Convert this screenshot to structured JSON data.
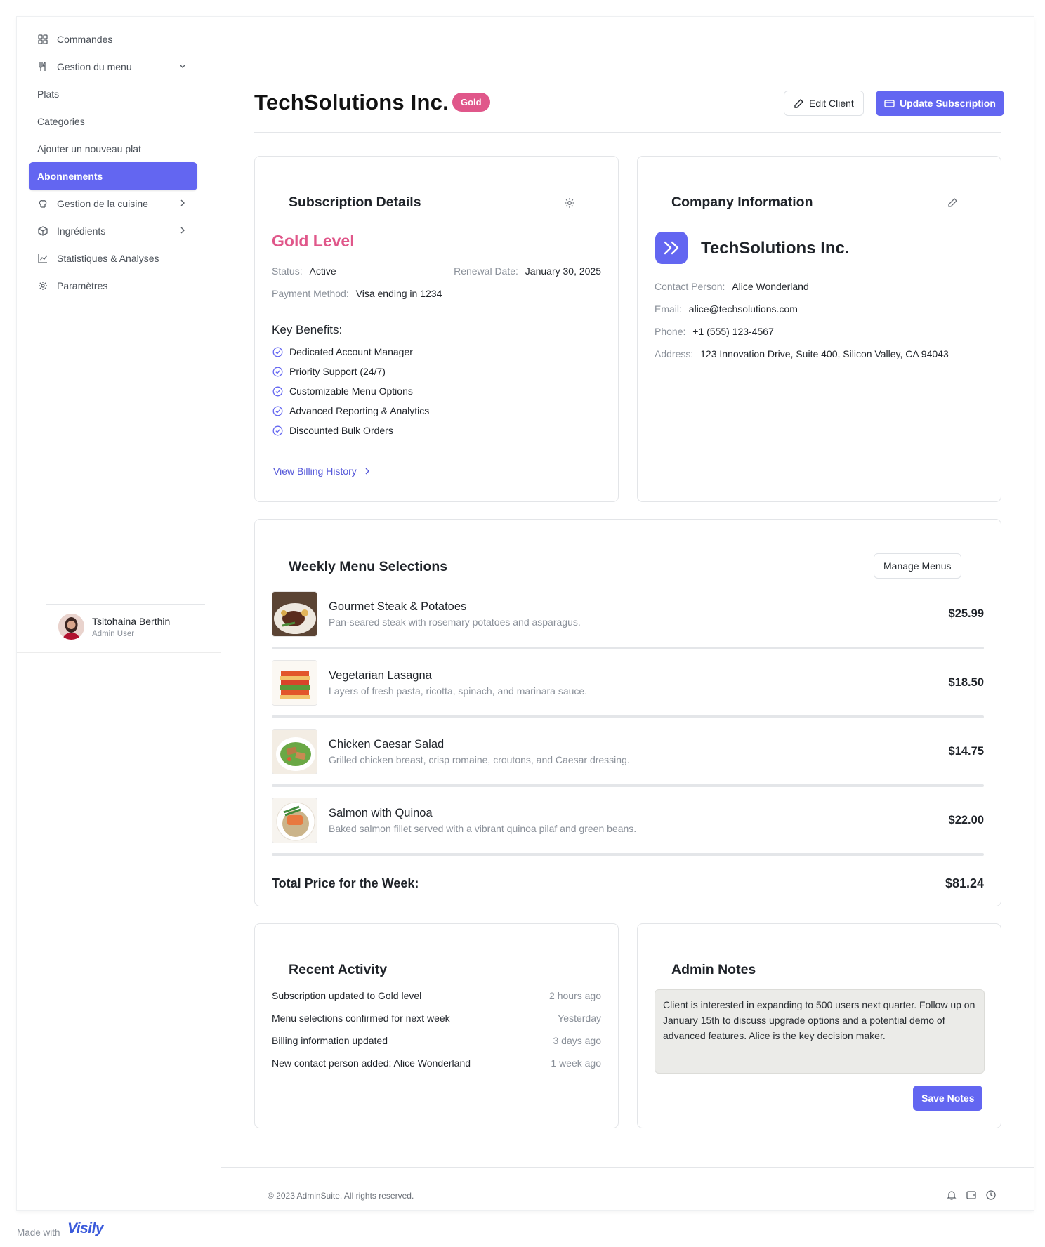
{
  "sidebar": {
    "items": [
      {
        "label": "Commandes",
        "icon": "grid-icon"
      },
      {
        "label": "Gestion du menu",
        "icon": "utensils-icon"
      },
      {
        "label": "Plats"
      },
      {
        "label": "Categories"
      },
      {
        "label": "Ajouter un nouveau plat"
      },
      {
        "label": "Abonnements"
      },
      {
        "label": "Gestion de la cuisine",
        "icon": "chef-hat-icon"
      },
      {
        "label": "Ingrédients",
        "icon": "box-icon"
      },
      {
        "label": "Statistiques & Analyses",
        "icon": "chart-icon"
      },
      {
        "label": "Paramètres",
        "icon": "gear-icon"
      }
    ],
    "user": {
      "name": "Tsitohaina Berthin",
      "role": "Admin User"
    }
  },
  "header": {
    "title": "TechSolutions Inc.",
    "badge": "Gold",
    "edit_label": "Edit Client",
    "update_label": "Update Subscription"
  },
  "subscription": {
    "title": "Subscription Details",
    "level": "Gold Level",
    "status_label": "Status:",
    "status": "Active",
    "renewal_label": "Renewal Date:",
    "renewal": "January 30, 2025",
    "payment_label": "Payment Method:",
    "payment": "Visa ending in 1234",
    "benefits_title": "Key Benefits:",
    "benefits": [
      "Dedicated Account Manager",
      "Priority Support (24/7)",
      "Customizable Menu Options",
      "Advanced Reporting & Analytics",
      "Discounted Bulk Orders"
    ],
    "billing_link": "View Billing History"
  },
  "company": {
    "title": "Company Information",
    "name": "TechSolutions Inc.",
    "contact_label": "Contact Person:",
    "contact": "Alice Wonderland",
    "email_label": "Email:",
    "email": "alice@techsolutions.com",
    "phone_label": "Phone:",
    "phone": "+1 (555) 123-4567",
    "address_label": "Address:",
    "address": "123 Innovation Drive, Suite 400, Silicon Valley, CA 94043"
  },
  "menus": {
    "title": "Weekly Menu Selections",
    "manage_label": "Manage Menus",
    "items": [
      {
        "name": "Gourmet Steak & Potatoes",
        "desc": "Pan-seared steak with rosemary potatoes and asparagus.",
        "price": "$25.99"
      },
      {
        "name": "Vegetarian Lasagna",
        "desc": "Layers of fresh pasta, ricotta, spinach, and marinara sauce.",
        "price": "$18.50"
      },
      {
        "name": "Chicken Caesar Salad",
        "desc": "Grilled chicken breast, crisp romaine, croutons, and Caesar dressing.",
        "price": "$14.75"
      },
      {
        "name": "Salmon with Quinoa",
        "desc": "Baked salmon fillet served with a vibrant quinoa pilaf and green beans.",
        "price": "$22.00"
      }
    ],
    "total_label": "Total Price for the Week:",
    "total": "$81.24"
  },
  "activity": {
    "title": "Recent Activity",
    "items": [
      {
        "text": "Subscription updated to Gold level",
        "when": "2 hours ago"
      },
      {
        "text": "Menu selections confirmed for next week",
        "when": "Yesterday"
      },
      {
        "text": "Billing information updated",
        "when": "3 days ago"
      },
      {
        "text": "New contact person added: Alice Wonderland",
        "when": "1 week ago"
      }
    ]
  },
  "notes": {
    "title": "Admin Notes",
    "text": "Client is interested in expanding to 500 users next quarter. Follow up on January 15th to discuss upgrade options and a potential demo of advanced features. Alice is the key decision maker.",
    "save_label": "Save Notes"
  },
  "footer": {
    "copyright": "© 2023 AdminSuite. All rights reserved.",
    "icons": [
      "bell-icon",
      "wallet-icon",
      "clock-icon"
    ]
  },
  "watermark": {
    "made_with": "Made with",
    "brand": "Visily"
  },
  "colors": {
    "accent": "#6366f1",
    "gold_badge": "#e0578a",
    "gold_level_text": "#e0578a"
  }
}
